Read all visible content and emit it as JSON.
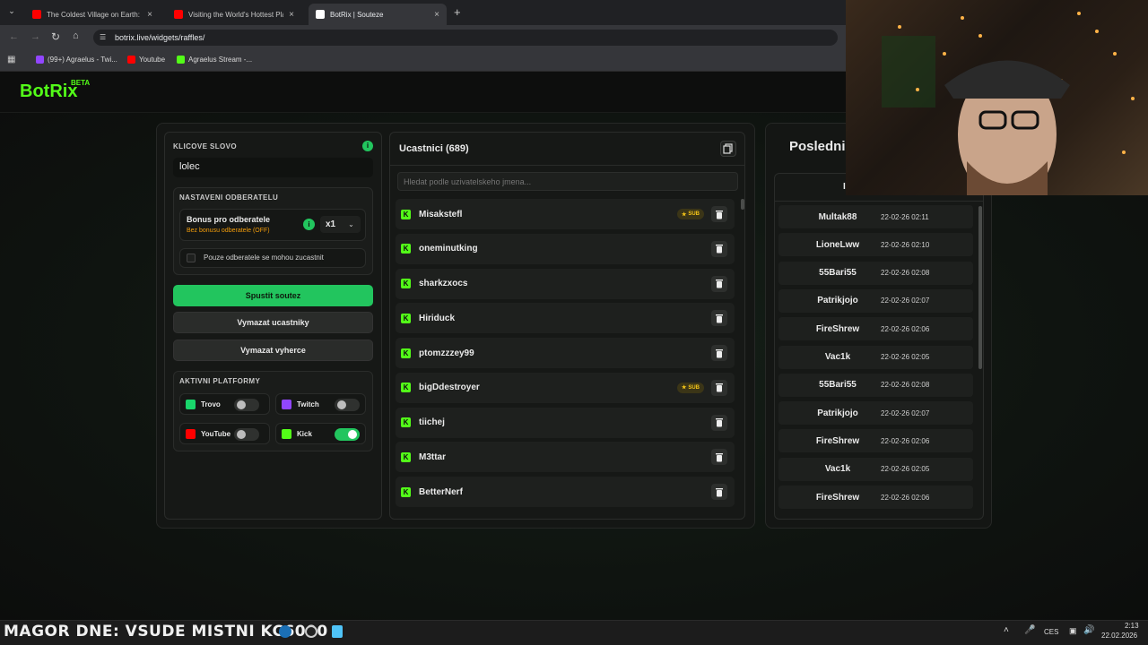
{
  "browser": {
    "tabs": [
      {
        "title": "The Coldest Village on Earth: O",
        "favicon_color": "#ff0000"
      },
      {
        "title": "Visiting the World's Hottest Pla",
        "favicon_color": "#ff0000"
      },
      {
        "title": "BotRix | Souteze",
        "favicon_color": "#ffffff"
      }
    ],
    "url": "botrix.live/widgets/raffles/",
    "bookmarks": [
      {
        "label": "(99+) Agraelus - Twi...",
        "color": "#9146ff"
      },
      {
        "label": "Youtube",
        "color": "#ff0000"
      },
      {
        "label": "Agraelus Stream -...",
        "color": "#53fc18"
      }
    ]
  },
  "app": {
    "logo": "BotRix",
    "badge": "BETA",
    "accent": "#53fc18"
  },
  "settings": {
    "keyword_label": "KLICOVE SLOVO",
    "keyword_value": "lolec",
    "sub_section_label": "NASTAVENI ODBERATELU",
    "bonus_title": "Bonus pro odberatele",
    "bonus_sub": "Bez bonusu odberatele (OFF)",
    "multiplier": "x1",
    "subs_only_label": "Pouze odberatele se mohou zucastnit",
    "start_btn": "Spustit soutez",
    "clear_participants_btn": "Vymazat ucastniky",
    "clear_winners_btn": "Vymazat vyherce",
    "platforms_label": "AKTIVNI PLATFORMY",
    "platforms": [
      {
        "name": "Trovo",
        "enabled": false,
        "color": "#19d66b"
      },
      {
        "name": "Twitch",
        "enabled": false,
        "color": "#9146ff"
      },
      {
        "name": "YouTube",
        "enabled": false,
        "color": "#ff0000"
      },
      {
        "name": "Kick",
        "enabled": true,
        "color": "#53fc18"
      }
    ]
  },
  "participants": {
    "title": "Ucastnici (689)",
    "search_placeholder": "Hledat podle uzivatelskeho jmena...",
    "sub_badge": "SUB",
    "list": [
      {
        "name": "Misakstefl",
        "sub": true
      },
      {
        "name": "oneminutking",
        "sub": false
      },
      {
        "name": "sharkzxocs",
        "sub": false
      },
      {
        "name": "Hiriduck",
        "sub": false
      },
      {
        "name": "ptomzzzey99",
        "sub": false
      },
      {
        "name": "bigDdestroyer",
        "sub": true
      },
      {
        "name": "tiichej",
        "sub": false
      },
      {
        "name": "M3ttar",
        "sub": false
      },
      {
        "name": "BetterNerf",
        "sub": false
      }
    ]
  },
  "winners": {
    "title": "Posledni",
    "header_fragment": "I",
    "list": [
      {
        "name": "Multak88",
        "time": "22-02-26 02:11"
      },
      {
        "name": "LioneLww",
        "time": "22-02-26 02:10"
      },
      {
        "name": "55Bari55",
        "time": "22-02-26 02:08"
      },
      {
        "name": "Patrikjojo",
        "time": "22-02-26 02:07"
      },
      {
        "name": "FireShrew",
        "time": "22-02-26 02:06"
      },
      {
        "name": "Vac1k",
        "time": "22-02-26 02:05"
      },
      {
        "name": "55Bari55",
        "time": "22-02-26 02:08"
      },
      {
        "name": "Patrikjojo",
        "time": "22-02-26 02:07"
      },
      {
        "name": "FireShrew",
        "time": "22-02-26 02:06"
      },
      {
        "name": "Vac1k",
        "time": "22-02-26 02:05"
      },
      {
        "name": "FireShrew",
        "time": "22-02-26 02:06"
      }
    ]
  },
  "taskbar": {
    "ticker": "MAGOR DNE: VSUDE   MISTNI KC6000",
    "lang": "CES",
    "time": "2:13",
    "date": "22.02.2026"
  }
}
